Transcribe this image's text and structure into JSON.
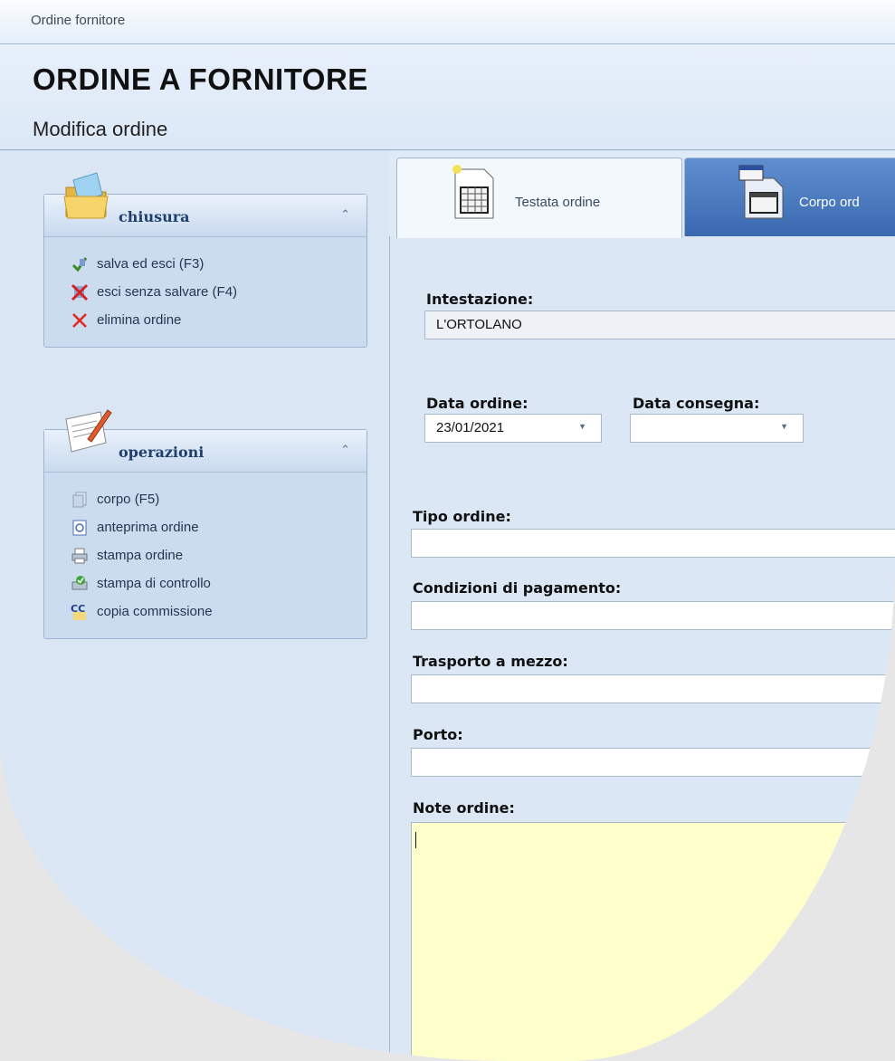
{
  "window": {
    "title": "Ordine fornitore"
  },
  "header": {
    "title": "ORDINE A FORNITORE",
    "subtitle": "Modifica ordine"
  },
  "sidebar": {
    "groups": [
      {
        "title": "chiusura",
        "icon": "open-folder-icon",
        "actions": [
          {
            "label": "salva ed esci (F3)",
            "icon": "save-exit-icon"
          },
          {
            "label": "esci senza salvare (F4)",
            "icon": "exit-no-save-icon"
          },
          {
            "label": "elimina ordine",
            "icon": "delete-icon"
          }
        ]
      },
      {
        "title": "operazioni",
        "icon": "edit-document-icon",
        "actions": [
          {
            "label": "corpo (F5)",
            "icon": "documents-icon"
          },
          {
            "label": "anteprima ordine",
            "icon": "preview-icon"
          },
          {
            "label": "stampa ordine",
            "icon": "printer-icon"
          },
          {
            "label": "stampa di controllo",
            "icon": "printer-check-icon"
          },
          {
            "label": "copia commissione",
            "icon": "cc-icon"
          }
        ]
      }
    ]
  },
  "tabs": [
    {
      "label": "Testata ordine",
      "active": true
    },
    {
      "label": "Corpo ord",
      "active": false
    }
  ],
  "form": {
    "intestazione": {
      "label": "Intestazione:",
      "value": "L'ORTOLANO"
    },
    "data_ordine": {
      "label": "Data ordine:",
      "value": "23/01/2021"
    },
    "data_consegna": {
      "label": "Data consegna:",
      "value": ""
    },
    "tipo_ordine": {
      "label": "Tipo ordine:",
      "value": ""
    },
    "condizioni_pagamento": {
      "label": "Condizioni di pagamento:",
      "value": ""
    },
    "trasporto": {
      "label": "Trasporto a mezzo:",
      "value": ""
    },
    "porto": {
      "label": "Porto:",
      "value": ""
    },
    "note": {
      "label": "Note ordine:",
      "value": ""
    }
  },
  "colors": {
    "note_bg": "#ffffcc",
    "tab_inactive": "#3a68b0",
    "group_title": "#1f3f6e"
  }
}
